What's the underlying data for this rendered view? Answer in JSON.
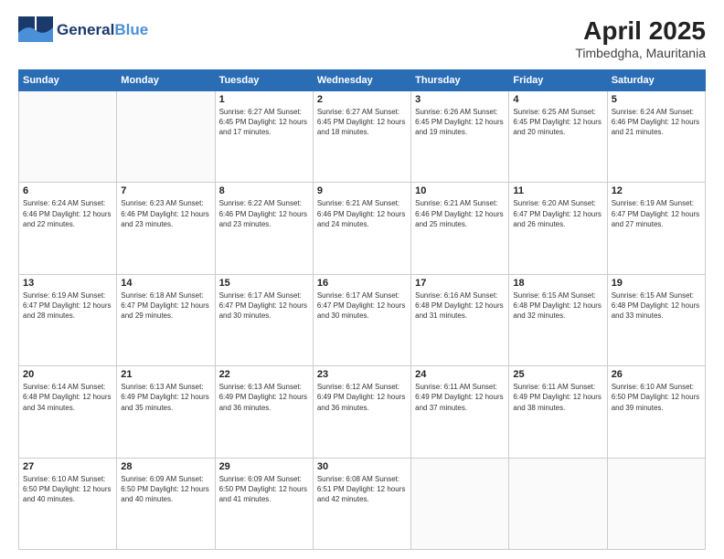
{
  "header": {
    "logo_line1a": "General",
    "logo_line1b": "Blue",
    "title": "April 2025",
    "location": "Timbedgha, Mauritania"
  },
  "weekdays": [
    "Sunday",
    "Monday",
    "Tuesday",
    "Wednesday",
    "Thursday",
    "Friday",
    "Saturday"
  ],
  "weeks": [
    [
      {
        "day": "",
        "info": ""
      },
      {
        "day": "",
        "info": ""
      },
      {
        "day": "1",
        "info": "Sunrise: 6:27 AM\nSunset: 6:45 PM\nDaylight: 12 hours and 17 minutes."
      },
      {
        "day": "2",
        "info": "Sunrise: 6:27 AM\nSunset: 6:45 PM\nDaylight: 12 hours and 18 minutes."
      },
      {
        "day": "3",
        "info": "Sunrise: 6:26 AM\nSunset: 6:45 PM\nDaylight: 12 hours and 19 minutes."
      },
      {
        "day": "4",
        "info": "Sunrise: 6:25 AM\nSunset: 6:45 PM\nDaylight: 12 hours and 20 minutes."
      },
      {
        "day": "5",
        "info": "Sunrise: 6:24 AM\nSunset: 6:46 PM\nDaylight: 12 hours and 21 minutes."
      }
    ],
    [
      {
        "day": "6",
        "info": "Sunrise: 6:24 AM\nSunset: 6:46 PM\nDaylight: 12 hours and 22 minutes."
      },
      {
        "day": "7",
        "info": "Sunrise: 6:23 AM\nSunset: 6:46 PM\nDaylight: 12 hours and 23 minutes."
      },
      {
        "day": "8",
        "info": "Sunrise: 6:22 AM\nSunset: 6:46 PM\nDaylight: 12 hours and 23 minutes."
      },
      {
        "day": "9",
        "info": "Sunrise: 6:21 AM\nSunset: 6:46 PM\nDaylight: 12 hours and 24 minutes."
      },
      {
        "day": "10",
        "info": "Sunrise: 6:21 AM\nSunset: 6:46 PM\nDaylight: 12 hours and 25 minutes."
      },
      {
        "day": "11",
        "info": "Sunrise: 6:20 AM\nSunset: 6:47 PM\nDaylight: 12 hours and 26 minutes."
      },
      {
        "day": "12",
        "info": "Sunrise: 6:19 AM\nSunset: 6:47 PM\nDaylight: 12 hours and 27 minutes."
      }
    ],
    [
      {
        "day": "13",
        "info": "Sunrise: 6:19 AM\nSunset: 6:47 PM\nDaylight: 12 hours and 28 minutes."
      },
      {
        "day": "14",
        "info": "Sunrise: 6:18 AM\nSunset: 6:47 PM\nDaylight: 12 hours and 29 minutes."
      },
      {
        "day": "15",
        "info": "Sunrise: 6:17 AM\nSunset: 6:47 PM\nDaylight: 12 hours and 30 minutes."
      },
      {
        "day": "16",
        "info": "Sunrise: 6:17 AM\nSunset: 6:47 PM\nDaylight: 12 hours and 30 minutes."
      },
      {
        "day": "17",
        "info": "Sunrise: 6:16 AM\nSunset: 6:48 PM\nDaylight: 12 hours and 31 minutes."
      },
      {
        "day": "18",
        "info": "Sunrise: 6:15 AM\nSunset: 6:48 PM\nDaylight: 12 hours and 32 minutes."
      },
      {
        "day": "19",
        "info": "Sunrise: 6:15 AM\nSunset: 6:48 PM\nDaylight: 12 hours and 33 minutes."
      }
    ],
    [
      {
        "day": "20",
        "info": "Sunrise: 6:14 AM\nSunset: 6:48 PM\nDaylight: 12 hours and 34 minutes."
      },
      {
        "day": "21",
        "info": "Sunrise: 6:13 AM\nSunset: 6:49 PM\nDaylight: 12 hours and 35 minutes."
      },
      {
        "day": "22",
        "info": "Sunrise: 6:13 AM\nSunset: 6:49 PM\nDaylight: 12 hours and 36 minutes."
      },
      {
        "day": "23",
        "info": "Sunrise: 6:12 AM\nSunset: 6:49 PM\nDaylight: 12 hours and 36 minutes."
      },
      {
        "day": "24",
        "info": "Sunrise: 6:11 AM\nSunset: 6:49 PM\nDaylight: 12 hours and 37 minutes."
      },
      {
        "day": "25",
        "info": "Sunrise: 6:11 AM\nSunset: 6:49 PM\nDaylight: 12 hours and 38 minutes."
      },
      {
        "day": "26",
        "info": "Sunrise: 6:10 AM\nSunset: 6:50 PM\nDaylight: 12 hours and 39 minutes."
      }
    ],
    [
      {
        "day": "27",
        "info": "Sunrise: 6:10 AM\nSunset: 6:50 PM\nDaylight: 12 hours and 40 minutes."
      },
      {
        "day": "28",
        "info": "Sunrise: 6:09 AM\nSunset: 6:50 PM\nDaylight: 12 hours and 40 minutes."
      },
      {
        "day": "29",
        "info": "Sunrise: 6:09 AM\nSunset: 6:50 PM\nDaylight: 12 hours and 41 minutes."
      },
      {
        "day": "30",
        "info": "Sunrise: 6:08 AM\nSunset: 6:51 PM\nDaylight: 12 hours and 42 minutes."
      },
      {
        "day": "",
        "info": ""
      },
      {
        "day": "",
        "info": ""
      },
      {
        "day": "",
        "info": ""
      }
    ]
  ]
}
